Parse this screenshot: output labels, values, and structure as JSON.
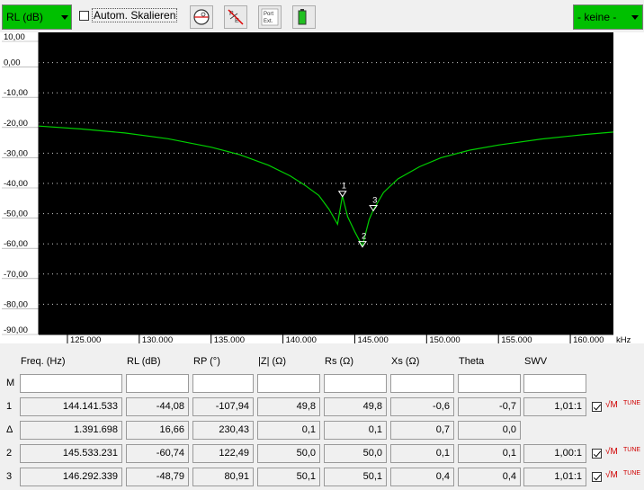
{
  "toolbar": {
    "mode_select_value": "RL (dB)",
    "auto_scale_label": "Autom. Skalieren",
    "auto_scale_checked": false,
    "right_select_value": "- keine -",
    "icons": [
      "polar-plot-icon",
      "clear-markers-icon",
      "port-extension-icon",
      "battery-icon"
    ],
    "port_ext_text_1": "Port",
    "port_ext_text_2": "Ext."
  },
  "chart_data": {
    "type": "line",
    "xlabel": "",
    "ylabel": "",
    "x_unit": "kHz",
    "xlim": [
      123000,
      163000
    ],
    "ylim": [
      -90,
      10
    ],
    "x_ticks": [
      "125.000",
      "130.000",
      "135.000",
      "140.000",
      "145.000",
      "150.000",
      "155.000",
      "160.000"
    ],
    "x_tick_values": [
      125000,
      130000,
      135000,
      140000,
      145000,
      150000,
      155000,
      160000
    ],
    "y_ticks": [
      "10,00",
      "0,00",
      "-10,00",
      "-20,00",
      "-30,00",
      "-40,00",
      "-50,00",
      "-60,00",
      "-70,00",
      "-80,00",
      "-90,00"
    ],
    "y_tick_values": [
      10,
      0,
      -10,
      -20,
      -30,
      -40,
      -50,
      -60,
      -70,
      -80,
      -90
    ],
    "grid": true,
    "background": "#000000",
    "series": [
      {
        "color": "#00d000",
        "x": [
          123000,
          126000,
          129000,
          132000,
          135000,
          137000,
          139000,
          140500,
          141500,
          142500,
          143200,
          143800,
          144140,
          144500,
          145000,
          145530,
          146000,
          146290,
          147000,
          148000,
          149500,
          151000,
          153000,
          155000,
          158000,
          161000,
          163000
        ],
        "y": [
          -21.0,
          -22.0,
          -23.3,
          -25.2,
          -28.0,
          -30.5,
          -34.0,
          -37.5,
          -40.5,
          -44.0,
          -48.5,
          -53.5,
          -44.08,
          -51.0,
          -56.0,
          -60.74,
          -52.0,
          -48.79,
          -43.0,
          -38.5,
          -34.5,
          -31.5,
          -29.0,
          -27.3,
          -25.3,
          -23.8,
          -23.0
        ]
      }
    ],
    "markers": [
      {
        "label": "1",
        "x": 144141.533,
        "y": -44.08
      },
      {
        "label": "2",
        "x": 145533.231,
        "y": -60.74
      },
      {
        "label": "3",
        "x": 146292.339,
        "y": -48.79
      }
    ]
  },
  "table": {
    "headers": [
      "Freq. (Hz)",
      "RL (dB)",
      "RP (°)",
      "|Z| (Ω)",
      "Rs (Ω)",
      "Xs (Ω)",
      "Theta",
      "SWV"
    ],
    "rows": [
      {
        "label": "M",
        "cells": [
          "",
          "",
          "",
          "",
          "",
          "",
          "",
          ""
        ],
        "has_controls": false
      },
      {
        "label": "1",
        "cells": [
          "144.141.533",
          "-44,08",
          "-107,94",
          "49,8",
          "49,8",
          "-0,6",
          "-0,7",
          "1,01:1"
        ],
        "has_controls": true
      },
      {
        "label": "Δ",
        "cells": [
          "1.391.698",
          "16,66",
          "230,43",
          "0,1",
          "0,1",
          "0,7",
          "0,0",
          ""
        ],
        "has_controls": false
      },
      {
        "label": "2",
        "cells": [
          "145.533.231",
          "-60,74",
          "122,49",
          "50,0",
          "50,0",
          "0,1",
          "0,1",
          "1,00:1"
        ],
        "has_controls": true
      },
      {
        "label": "3",
        "cells": [
          "146.292.339",
          "-48,79",
          "80,91",
          "50,1",
          "50,1",
          "0,4",
          "0,4",
          "1,01:1"
        ],
        "has_controls": true
      }
    ],
    "marker_icon_m": "√M",
    "marker_icon_tune": "TUNE"
  }
}
